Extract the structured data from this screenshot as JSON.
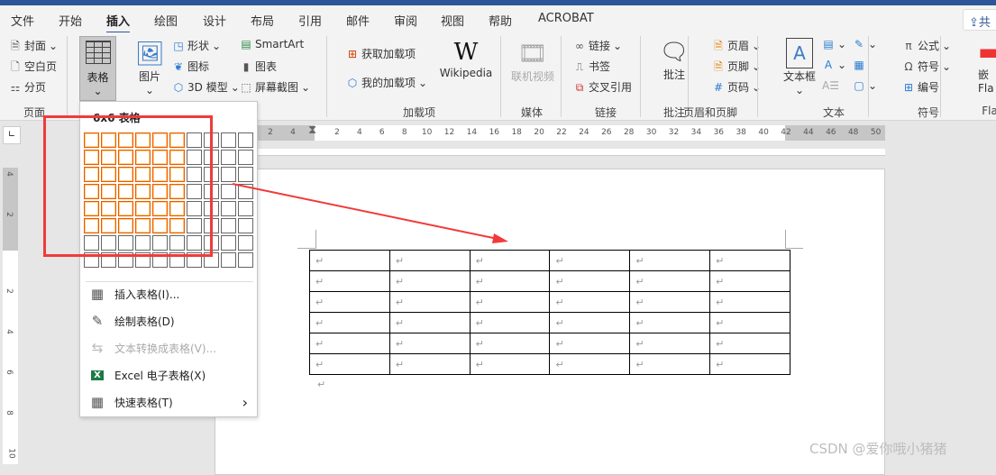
{
  "tabs": [
    "文件",
    "开始",
    "插入",
    "绘图",
    "设计",
    "布局",
    "引用",
    "邮件",
    "审阅",
    "视图",
    "帮助",
    "ACROBAT"
  ],
  "active_tab": "插入",
  "share_label": "共",
  "ribbon": {
    "pages": {
      "items": [
        "封面",
        "空白页",
        "分页"
      ],
      "label": "页面"
    },
    "table": {
      "label": "表格"
    },
    "illustrations": {
      "picture": "图片",
      "shape": "形状",
      "icon": "图标",
      "model3d": "3D 模型",
      "smartart": "SmartArt",
      "chart": "图表",
      "screenshot": "屏幕截图"
    },
    "addins": {
      "get": "获取加载项",
      "mine": "我的加载项",
      "wikipedia": "Wikipedia",
      "label": "加载项"
    },
    "media": {
      "video": "联机视频",
      "label": "媒体"
    },
    "links": {
      "link": "链接",
      "bookmark": "书签",
      "crossref": "交叉引用",
      "label": "链接"
    },
    "comments": {
      "comment": "批注",
      "label": "批注"
    },
    "header_footer": {
      "header": "页眉",
      "footer": "页脚",
      "page_number": "页码",
      "label": "页眉和页脚"
    },
    "text": {
      "textbox": "文本框",
      "label": "文本"
    },
    "symbols": {
      "equation": "公式",
      "symbol": "符号",
      "number": "编号",
      "label": "符号"
    },
    "embed": {
      "label1": "嵌",
      "label2": "Fla",
      "group": "Fla"
    }
  },
  "ruler_ticks": [
    "4",
    "2",
    "2",
    "4",
    "6",
    "8",
    "10",
    "12",
    "14",
    "16",
    "18",
    "20",
    "22",
    "24",
    "26",
    "28",
    "30",
    "32",
    "34",
    "36",
    "38",
    "40",
    "42",
    "44",
    "46",
    "48",
    "50"
  ],
  "vruler_ticks": [
    "4",
    "2",
    "2",
    "4",
    "6",
    "8",
    "10"
  ],
  "dropdown": {
    "title": "6x6 表格",
    "grid_cols": 10,
    "grid_rows": 8,
    "selected_cols": 6,
    "selected_rows": 6,
    "items": [
      {
        "label": "插入表格(I)...",
        "icon": "table-icon",
        "disabled": false
      },
      {
        "label": "绘制表格(D)",
        "icon": "draw-table-icon",
        "disabled": false
      },
      {
        "label": "文本转换成表格(V)...",
        "icon": "convert-text-icon",
        "disabled": true
      },
      {
        "label": "Excel 电子表格(X)",
        "icon": "excel-icon",
        "disabled": false
      },
      {
        "label": "快速表格(T)",
        "icon": "quick-table-icon",
        "disabled": false
      }
    ]
  },
  "document": {
    "table_rows": 6,
    "table_cols": 6,
    "paragraph_mark": "↵"
  },
  "watermark": "CSDN @爱你哦小猪猪",
  "colors": {
    "accent": "#2b579a",
    "highlight": "#e8590c",
    "annotation": "#f23a3a"
  }
}
